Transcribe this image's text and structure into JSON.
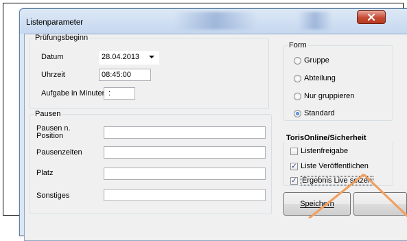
{
  "window": {
    "title": "Listenparameter"
  },
  "pruefungsbeginn": {
    "legend": "Prüfungsbeginn",
    "datum_label": "Datum",
    "datum_value": "28.04.2013",
    "uhrzeit_label": "Uhrzeit",
    "uhrzeit_value": "08:45:00",
    "aufgabe_label": "Aufgabe in Minuten",
    "aufgabe_value": " :"
  },
  "pausen": {
    "legend": "Pausen",
    "position_label": "Pausen n. Position",
    "position_value": "",
    "zeiten_label": "Pausenzeiten",
    "zeiten_value": "",
    "platz_label": "Platz",
    "platz_value": "",
    "sonstiges_label": "Sonstiges",
    "sonstiges_value": ""
  },
  "form": {
    "legend": "Form",
    "options": [
      "Gruppe",
      "Abteilung",
      "Nur gruppieren",
      "Standard"
    ],
    "selected": "Standard"
  },
  "toris": {
    "heading": "TorisOnline/Sicherheit",
    "checks": [
      {
        "label": "Listenfreigabe",
        "checked": false
      },
      {
        "label": "Liste Veröffentlichen",
        "checked": true
      },
      {
        "label": "Ergebnis Live setzen",
        "checked": true
      }
    ]
  },
  "buttons": {
    "save": "Speichern"
  },
  "colors": {
    "annotation_arrow": "#f0a060",
    "close_button": "#c44b33",
    "radio_selected": "#1c5fb2"
  }
}
